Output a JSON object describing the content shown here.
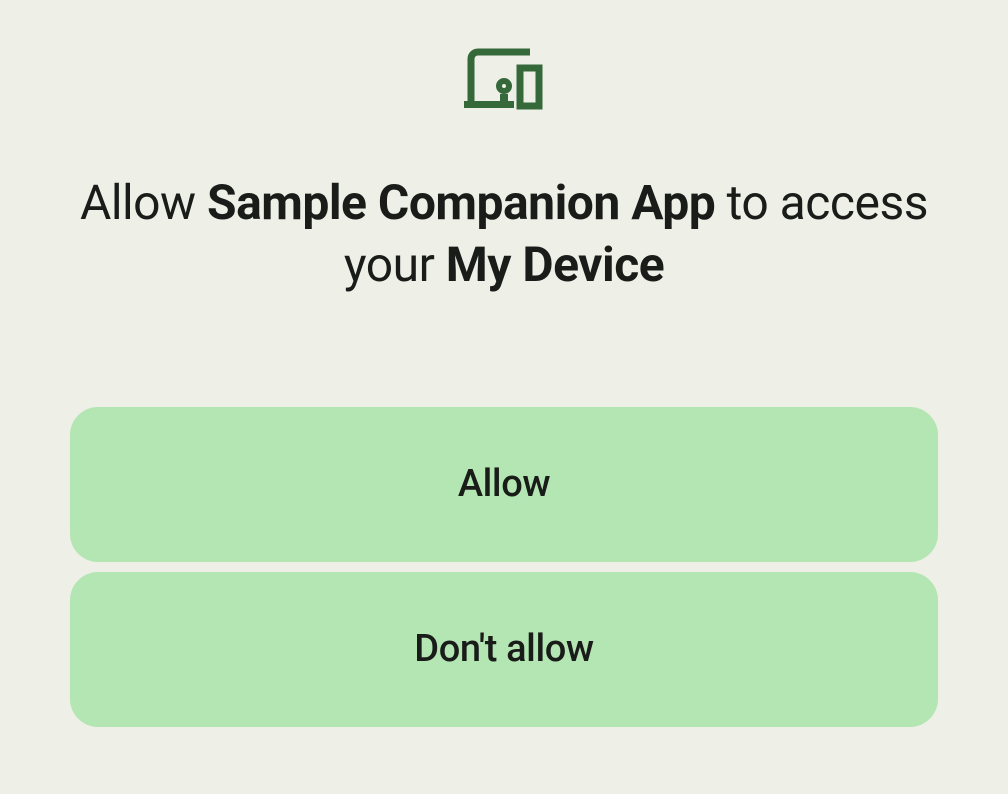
{
  "heading": {
    "pre": "Allow ",
    "app_name": "Sample Companion App",
    "mid": " to access your ",
    "device_name": "My Device"
  },
  "buttons": {
    "allow": "Allow",
    "deny": "Don't allow"
  },
  "icon_color": "#35693a"
}
